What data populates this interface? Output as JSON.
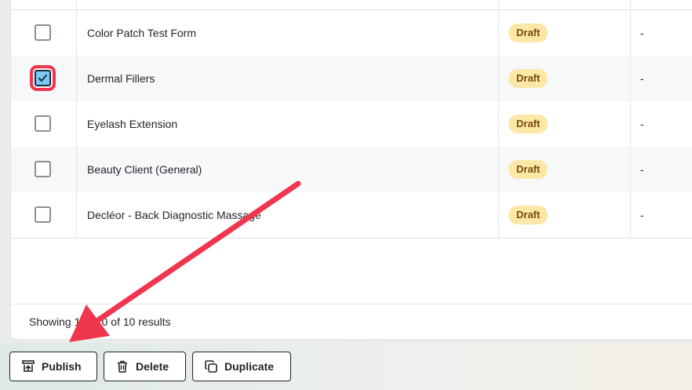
{
  "table": {
    "rows": [
      {
        "name": "Color Patch Test Form",
        "status": "Draft",
        "extra": "-",
        "checked": false
      },
      {
        "name": "Dermal Fillers",
        "status": "Draft",
        "extra": "-",
        "checked": true
      },
      {
        "name": "Eyelash Extension",
        "status": "Draft",
        "extra": "-",
        "checked": false
      },
      {
        "name": "Beauty Client (General)",
        "status": "Draft",
        "extra": "-",
        "checked": false
      },
      {
        "name": "Decléor - Back Diagnostic Massage",
        "status": "Draft",
        "extra": "-",
        "checked": false
      }
    ],
    "results_text": "Showing 1 to 10 of 10 results"
  },
  "actions": {
    "publish": "Publish",
    "delete": "Delete",
    "duplicate": "Duplicate"
  },
  "colors": {
    "annotation_red": "#f0364f",
    "badge_bg": "#fbe7a6",
    "badge_text": "#7a4a08",
    "checkbox_checked": "#7cc8f5"
  },
  "icons": {
    "publish": "publish-icon",
    "delete": "trash-icon",
    "duplicate": "duplicate-icon",
    "check": "checkmark-icon"
  }
}
